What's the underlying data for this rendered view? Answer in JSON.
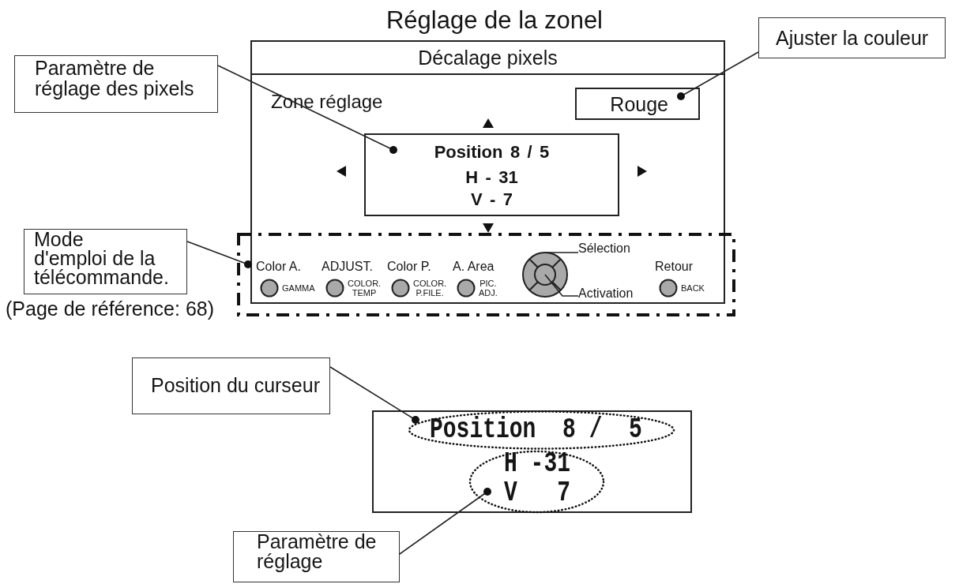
{
  "title": "Réglage de la zonel",
  "menu": {
    "header": "Décalage pixels",
    "area_label": "Zone réglage",
    "color_value": "Rouge",
    "readout": [
      "Position 8 / 5",
      "H - 31",
      "V - 7"
    ]
  },
  "remote": {
    "controls": [
      {
        "kind": "key",
        "label": "Color A.",
        "key_text": "GAMMA"
      },
      {
        "kind": "key",
        "label": "ADJUST.",
        "key_text": "COLOR.\nTEMP"
      },
      {
        "kind": "key",
        "label": "Color P.",
        "key_text": "COLOR.\nP.FILE."
      },
      {
        "kind": "key",
        "label": "A. Area",
        "key_text": "PIC.\nADJ."
      },
      {
        "kind": "pad",
        "select_label": "Sélection",
        "enter_label": "Activation"
      },
      {
        "kind": "key",
        "label": "Retour",
        "key_text": "BACK"
      }
    ]
  },
  "callouts": [
    {
      "text": "Paramètre de\nréglage des pixels"
    },
    {
      "text": "Ajuster la couleur"
    },
    {
      "text": "Mode\nd'emploi de la\ntélécommande."
    },
    {
      "text": "Position du curseur"
    },
    {
      "text": "Paramètre de\nréglage"
    }
  ],
  "reference_note": "(Page de référence: 68)",
  "display_detail": {
    "lines": [
      "Position  8 /  5",
      "H -31",
      "V   7"
    ]
  }
}
